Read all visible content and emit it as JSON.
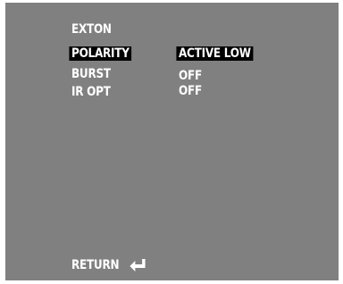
{
  "menu": {
    "items": [
      {
        "label": "EXTON",
        "value": ""
      },
      {
        "label": "POLARITY",
        "value": "ACTIVE LOW"
      },
      {
        "label": "BURST",
        "value": "OFF"
      },
      {
        "label": "IR OPT",
        "value": "OFF"
      }
    ],
    "return_label": "RETURN",
    "return_icon": "enter-arrow-icon"
  },
  "colors": {
    "background": "#808080",
    "text": "#ffffff",
    "highlight": "#000000"
  }
}
